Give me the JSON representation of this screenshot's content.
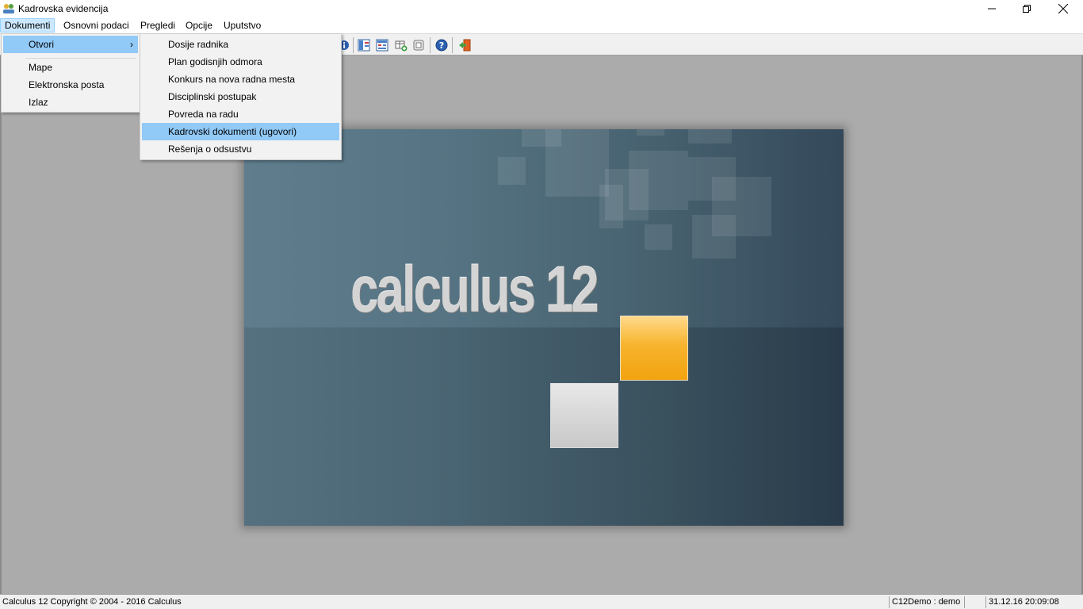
{
  "window": {
    "title": "Kadrovska evidencija",
    "icon": "app-icon"
  },
  "menubar": {
    "items": [
      "Dokumenti",
      "Osnovni podaci",
      "Pregledi",
      "Opcije",
      "Uputstvo"
    ]
  },
  "dokumenti_menu": {
    "items": [
      {
        "label": "Otvori",
        "has_submenu": true,
        "highlighted": true
      },
      {
        "label": "Mape"
      },
      {
        "label": "Elektronska posta"
      },
      {
        "label": "Izlaz"
      }
    ]
  },
  "otvori_submenu": {
    "items": [
      {
        "label": "Dosije radnika"
      },
      {
        "label": "Plan godisnjih odmora"
      },
      {
        "label": "Konkurs na nova radna mesta"
      },
      {
        "label": "Disciplinski postupak"
      },
      {
        "label": "Povreda na radu"
      },
      {
        "label": "Kadrovski dokumenti (ugovori)",
        "highlighted": true
      },
      {
        "label": "Rešenja o odsustvu"
      }
    ]
  },
  "toolbar": {
    "icons": [
      "info-icon",
      "layout-icon",
      "list-view-icon",
      "add-table-icon",
      "print-icon",
      "help-icon",
      "exit-icon"
    ]
  },
  "splash": {
    "brand": "calculus 12",
    "accent": "#f7b42e"
  },
  "statusbar": {
    "copyright": "Calculus 12  Copyright © 2004 - 2016  Calculus",
    "user": "C12Demo : demo",
    "datetime": "31.12.16 20:09:08"
  },
  "colors": {
    "highlight": "#91c9f7",
    "menu_active": "#cce8ff",
    "workspace": "#ababab"
  }
}
